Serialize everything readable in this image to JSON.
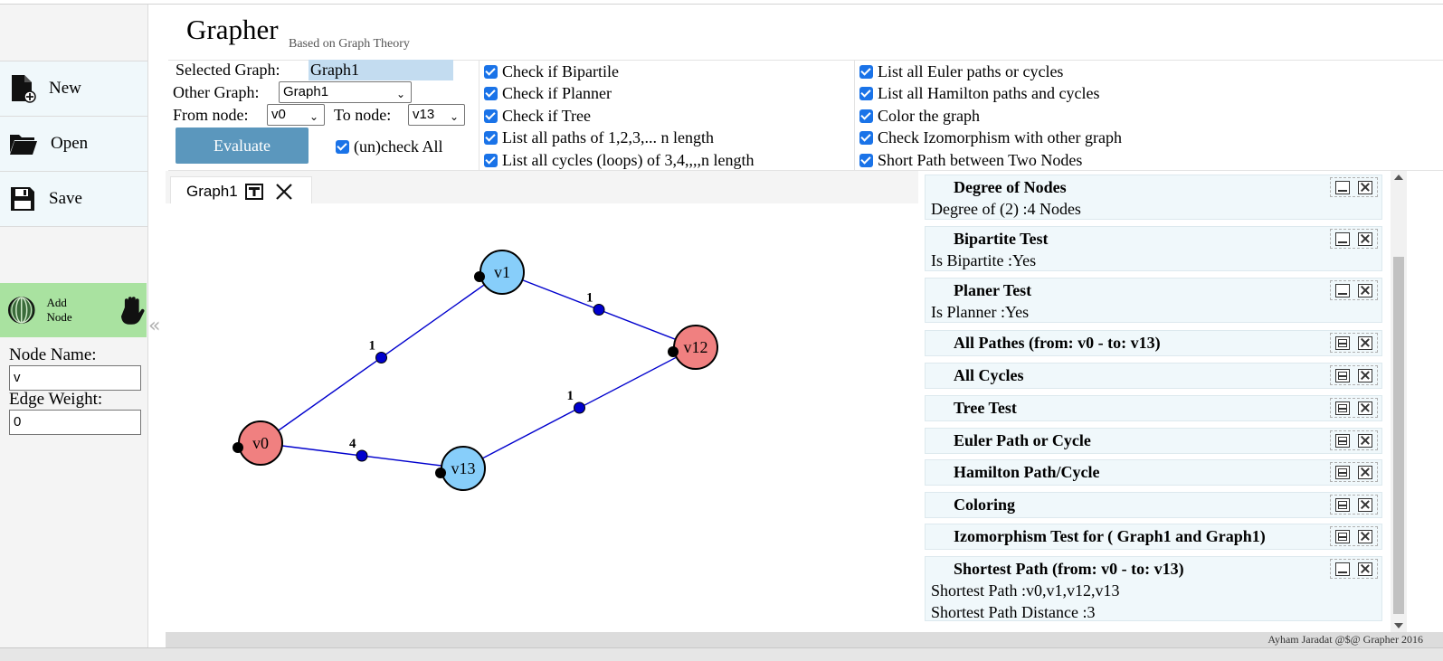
{
  "app": {
    "title": "Grapher",
    "subtitle": "Based on Graph Theory"
  },
  "sidebar": {
    "buttons": [
      {
        "label": "New",
        "icon": "new-file-icon"
      },
      {
        "label": "Open",
        "icon": "folder-icon"
      },
      {
        "label": "Save",
        "icon": "floppy-disk-icon"
      }
    ],
    "add_node": {
      "label": "Add Node",
      "icons": [
        "globe-icon",
        "hand-icon"
      ]
    },
    "node_name_label": "Node Name:",
    "node_name_value": "v",
    "edge_weight_label": "Edge Weight:",
    "edge_weight_value": "0"
  },
  "controls": {
    "selected_graph_label": "Selected Graph:",
    "selected_graph_value": "Graph1",
    "other_graph_label": "Other Graph:",
    "other_graph_value": "Graph1",
    "from_node_label": "From node:",
    "from_node_value": "v0",
    "to_node_label": "To node:",
    "to_node_value": "v13",
    "evaluate_label": "Evaluate",
    "uncheck_all_label": "(un)check All",
    "options_col1": [
      "Check if Bipartile",
      "Check if Planner",
      "Check if Tree",
      "List all paths of 1,2,3,... n length",
      "List all cycles (loops) of 3,4,,,,n length"
    ],
    "options_col2": [
      "List all Euler paths or cycles",
      "List all Hamilton paths and cycles",
      "Color the graph",
      "Check Izomorphism with other graph",
      "Short Path between Two Nodes"
    ]
  },
  "graph": {
    "tab_label": "Graph1",
    "nodes": [
      {
        "name": "v0",
        "color": "#f08080"
      },
      {
        "name": "v1",
        "color": "#87cefa"
      },
      {
        "name": "v12",
        "color": "#f08080"
      },
      {
        "name": "v13",
        "color": "#87cefa"
      }
    ],
    "edges": [
      {
        "from": "v0",
        "to": "v1",
        "weight": "1"
      },
      {
        "from": "v1",
        "to": "v12",
        "weight": "1"
      },
      {
        "from": "v13",
        "to": "v12",
        "weight": "1"
      },
      {
        "from": "v0",
        "to": "v13",
        "weight": "4"
      }
    ],
    "edge_color": "#0000cd"
  },
  "results": [
    {
      "title": "Degree of Nodes",
      "lines": [
        "Degree of (2) :4 Nodes"
      ],
      "state": "expanded"
    },
    {
      "title": "Bipartite Test",
      "lines": [
        "Is Bipartite :Yes"
      ],
      "state": "expanded"
    },
    {
      "title": "Planer Test",
      "lines": [
        "Is Planner :Yes"
      ],
      "state": "expanded"
    },
    {
      "title": "All Pathes (from: v0 - to: v13)",
      "lines": [],
      "state": "collapsed"
    },
    {
      "title": "All Cycles",
      "lines": [],
      "state": "collapsed"
    },
    {
      "title": "Tree Test",
      "lines": [],
      "state": "collapsed"
    },
    {
      "title": "Euler Path or Cycle",
      "lines": [],
      "state": "collapsed"
    },
    {
      "title": "Hamilton Path/Cycle",
      "lines": [],
      "state": "collapsed"
    },
    {
      "title": "Coloring",
      "lines": [],
      "state": "collapsed"
    },
    {
      "title": "Izomorphism Test for ( Graph1 and Graph1)",
      "lines": [],
      "state": "collapsed"
    },
    {
      "title": "Shortest Path (from: v0 - to: v13)",
      "lines": [
        "Shortest Path :v0,v1,v12,v13",
        "Shortest Path Distance :3"
      ],
      "state": "expanded"
    }
  ],
  "footer": {
    "credit": "Ayham Jaradat @$@ Grapher 2016"
  }
}
